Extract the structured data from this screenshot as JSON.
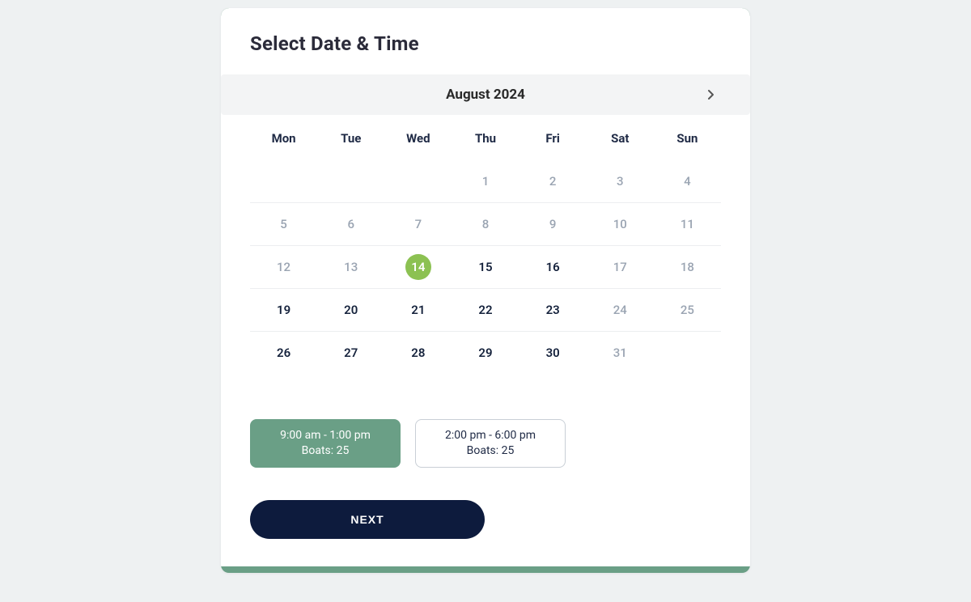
{
  "title": "Select Date & Time",
  "month": {
    "label": "August 2024",
    "has_prev": false,
    "has_next": true
  },
  "days_of_week": [
    "Mon",
    "Tue",
    "Wed",
    "Thu",
    "Fri",
    "Sat",
    "Sun"
  ],
  "weeks": [
    [
      {
        "d": ""
      },
      {
        "d": ""
      },
      {
        "d": ""
      },
      {
        "d": "1",
        "muted": true
      },
      {
        "d": "2",
        "muted": true
      },
      {
        "d": "3",
        "muted": true
      },
      {
        "d": "4",
        "muted": true
      }
    ],
    [
      {
        "d": "5",
        "muted": true
      },
      {
        "d": "6",
        "muted": true
      },
      {
        "d": "7",
        "muted": true
      },
      {
        "d": "8",
        "muted": true
      },
      {
        "d": "9",
        "muted": true
      },
      {
        "d": "10",
        "muted": true
      },
      {
        "d": "11",
        "muted": true
      }
    ],
    [
      {
        "d": "12",
        "muted": true
      },
      {
        "d": "13",
        "muted": true
      },
      {
        "d": "14",
        "selected": true
      },
      {
        "d": "15",
        "bold": true
      },
      {
        "d": "16",
        "bold": true
      },
      {
        "d": "17",
        "muted": true
      },
      {
        "d": "18",
        "muted": true
      }
    ],
    [
      {
        "d": "19",
        "bold": true
      },
      {
        "d": "20",
        "bold": true
      },
      {
        "d": "21",
        "bold": true
      },
      {
        "d": "22",
        "bold": true
      },
      {
        "d": "23",
        "bold": true
      },
      {
        "d": "24",
        "muted": true
      },
      {
        "d": "25",
        "muted": true
      }
    ],
    [
      {
        "d": "26",
        "bold": true
      },
      {
        "d": "27",
        "bold": true
      },
      {
        "d": "28",
        "bold": true
      },
      {
        "d": "29",
        "bold": true
      },
      {
        "d": "30",
        "bold": true
      },
      {
        "d": "31",
        "muted": true
      },
      {
        "d": ""
      }
    ]
  ],
  "slots": [
    {
      "time_range": "9:00 am - 1:00 pm",
      "boats_label": "Boats: 25",
      "selected": true
    },
    {
      "time_range": "2:00 pm - 6:00 pm",
      "boats_label": "Boats: 25",
      "selected": false
    }
  ],
  "buttons": {
    "next": "NEXT"
  },
  "colors": {
    "accent_green": "#6a9f86",
    "selected_day": "#8cc152",
    "primary_dark": "#0d1b3d"
  }
}
